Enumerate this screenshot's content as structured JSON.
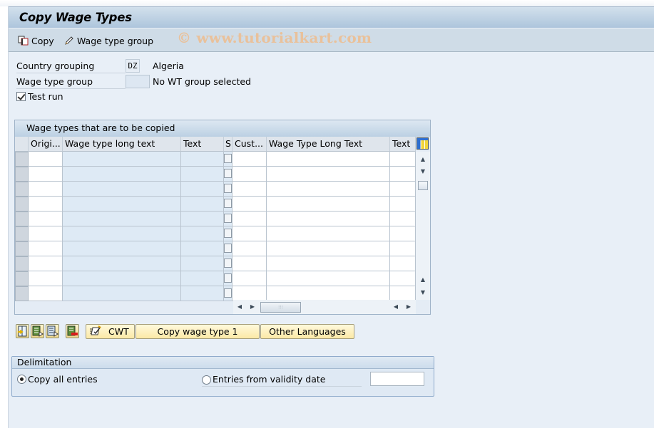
{
  "window": {
    "title": "Copy Wage Types",
    "watermark": "© www.tutorialkart.com"
  },
  "toolbar": {
    "copy_label": "Copy",
    "copy_icon": "copy-icon",
    "wage_type_group_label": "Wage type group",
    "wage_type_group_icon": "pencil-icon"
  },
  "form": {
    "country_grouping": {
      "label": "Country grouping",
      "value": "DZ",
      "text": "Algeria"
    },
    "wage_type_group": {
      "label": "Wage type group",
      "value": "",
      "text": "No WT group selected"
    },
    "test_run": {
      "label": "Test run",
      "checked": true
    }
  },
  "table": {
    "title": "Wage types that are to be copied",
    "columns": [
      "Origi...",
      "Wage type long text",
      "Text",
      "S",
      "Cust...",
      "Wage Type Long Text",
      "Text"
    ],
    "row_count": 10,
    "rows": [],
    "column_settings_icon": "layout-columns-icon",
    "hscroll_grip": ":::"
  },
  "actions": {
    "icon_buttons": [
      "select-all-icon",
      "select-block-icon",
      "deselect-all-icon",
      "delete-row-icon"
    ],
    "cwt_label": "CWT",
    "cwt_icon": "edit-document-icon",
    "copy_wage_type_label": "Copy wage type 1",
    "other_languages_label": "Other Languages"
  },
  "delimitation": {
    "title": "Delimitation",
    "options": [
      {
        "label": "Copy all entries",
        "selected": true
      },
      {
        "label": "Entries from validity date",
        "selected": false
      }
    ],
    "validity_date": ""
  }
}
